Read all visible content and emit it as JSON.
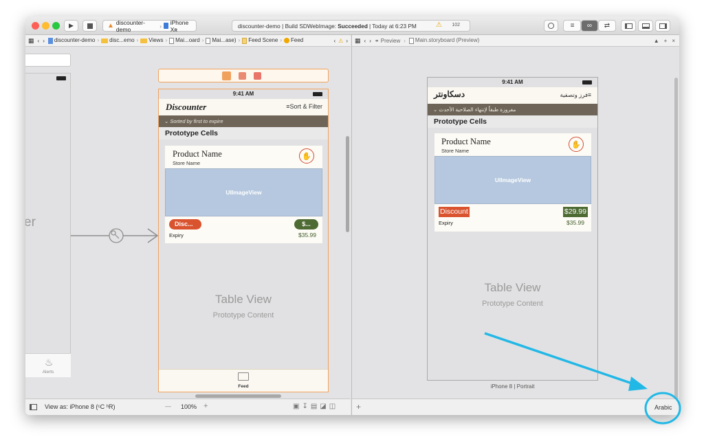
{
  "toolbar": {
    "scheme_project": "discounter-demo",
    "scheme_device": "iPhone Xʀ",
    "activity_prefix": "discounter-demo | Build SDWebImage: ",
    "activity_status": "Succeeded",
    "activity_suffix": "| Today at 6:23 PM",
    "warning_count": "102"
  },
  "jumpbar_left": {
    "crumbs": [
      "discounter-demo",
      "disc...emo",
      "Views",
      "Mai...oard",
      "Mai...ase)",
      "Feed Scene",
      "Feed"
    ]
  },
  "jumpbar_right": {
    "crumbs": [
      "Preview",
      "Main.storyboard (Preview)"
    ]
  },
  "left_scene": {
    "partial_text": "er",
    "tab_alerts": "Alerts"
  },
  "feed_scene": {
    "time": "9:41 AM",
    "title": "Discounter",
    "sort_filter": "Sort & Filter",
    "sort_banner": "Sorted by first to expire",
    "section_header": "Prototype Cells",
    "product_name": "Product Name",
    "store_name": "Store Name",
    "image_label": "UIImageView",
    "discount_badge": "Disc...",
    "price_badge": "$...",
    "expiry": "Expiry",
    "original_price": "$35.99",
    "table_view": "Table View",
    "prototype_content": "Prototype Content",
    "tab_feed": "Feed"
  },
  "preview_scene": {
    "time": "9:41 AM",
    "title_ar": "دسكاونتر",
    "sort_ar": "فرز وتصفية",
    "banner_ar": "مفروزة طبقاً لإنتهاء الصلاحية الأحدث",
    "section_header": "Prototype Cells",
    "product_name": "Product Name",
    "store_name": "Store Name",
    "image_label": "UIImageView",
    "discount_badge": "Discount",
    "price_badge": "$29.99",
    "expiry": "Expiry",
    "original_price": "$35.99",
    "table_view": "Table View",
    "prototype_content": "Prototype Content",
    "device_caption": "iPhone 8 | Portrait"
  },
  "bottom_left": {
    "view_as": "View as: iPhone 8 (ᶜC ʰR)",
    "zoom": "100%",
    "minus": "—",
    "plus": "+"
  },
  "bottom_right": {
    "plus": "+",
    "language": "Arabic"
  },
  "colors": {
    "accent_red": "#d9532f",
    "banner_brown": "#6e6558",
    "price_green": "#4d6b32",
    "storyboard_orange": "#f0a15b",
    "annotation_cyan": "#22b8e6"
  }
}
